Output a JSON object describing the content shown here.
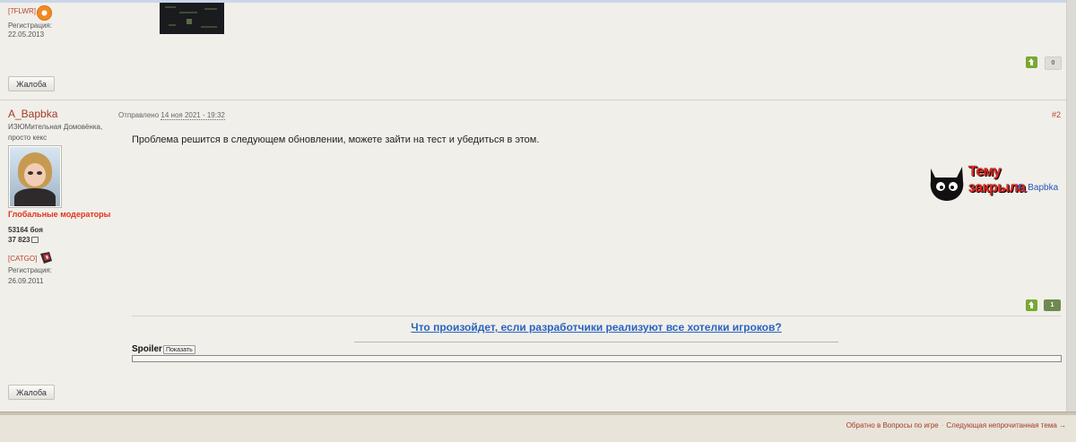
{
  "post1": {
    "clan_tag": "[7FLWR]",
    "reg_label": "Регистрация:",
    "reg_date": "22.05.2013",
    "complain_label": "Жалоба",
    "rating": "0"
  },
  "post2": {
    "username": "A_Bapbka",
    "status": "ИЗЮМительная Домовёнка, просто кекс",
    "group": "Глобальные модераторы",
    "fights": "53164 боя",
    "messages": "37 823",
    "clan_tag": "[CATGO]",
    "reg_label": "Регистрация:",
    "reg_date": "26.09.2011",
    "posted_prefix": "Отправлено",
    "posted_date": "14 ноя 2021 - 19:32",
    "post_number": "#2",
    "body": "Проблема решится в следующем обновлении, можете зайти на тест и убедиться в этом.",
    "stamp_title": "Тему закрыла",
    "stamp_author": "A_Bapbka",
    "rating": "1",
    "signature_link": "Что произойдет, если разработчики реализуют все хотелки игроков?",
    "spoiler_label": "Spoiler",
    "spoiler_button": "Показать",
    "complain_label": "Жалоба"
  },
  "footer": {
    "back_link": "Обратно в Вопросы по игре",
    "next_link": "Следующая непрочитанная тема →"
  },
  "colors": {
    "background": "#f1efe9",
    "username": "#a63a27",
    "moderator_group": "#e0321b",
    "link": "#2a63c1",
    "vote_up": "#79a832"
  }
}
